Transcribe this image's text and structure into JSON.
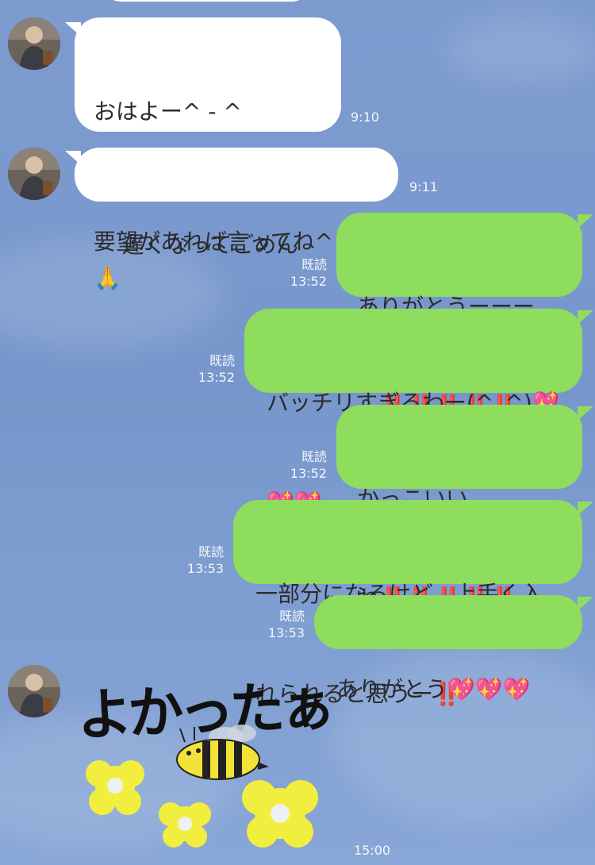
{
  "messages": [
    {
      "id": "m1",
      "dir": "in",
      "lines": [
        "おはよー^ - ^",
        "遅くなってごめん"
      ],
      "emoji_end": "🙏",
      "time": "9:10"
    },
    {
      "id": "m2",
      "dir": "in",
      "lines": [
        "要望があれば言ってね^ - ^"
      ],
      "time": "9:11"
    },
    {
      "id": "m3",
      "dir": "out",
      "line1": "ありがとうーーー",
      "line2": "ー",
      "emoji": "‼️‼️‼️‼️‼️",
      "read": "既読",
      "time": "13:52"
    },
    {
      "id": "m4",
      "dir": "out",
      "line1": "バッチリすぎるわー(^_^)",
      "emoji1": "💖",
      "emoji2": "💖💖",
      "read": "既読",
      "time": "13:52"
    },
    {
      "id": "m5",
      "dir": "out",
      "line1": "かっこいい",
      "line2": "ね",
      "emoji": "‼️‼️‼️‼️‼️",
      "read": "既読",
      "time": "13:52"
    },
    {
      "id": "m6",
      "dir": "out",
      "line1": "一部分になるけど、上手く入",
      "line2": "れられると思うー",
      "emoji": "‼️",
      "read": "既読",
      "time": "13:53"
    },
    {
      "id": "m7",
      "dir": "out",
      "line1": "ありがとう",
      "emoji": "💖💖💖",
      "read": "既読",
      "time": "13:53"
    }
  ],
  "sticker": {
    "text": "よかったぁ",
    "time": "15:00",
    "icon": "bee-flowers-sticker"
  },
  "colors": {
    "incoming": "#ffffff",
    "outgoing": "#8fdd5c",
    "background": "#7d9bcf"
  }
}
